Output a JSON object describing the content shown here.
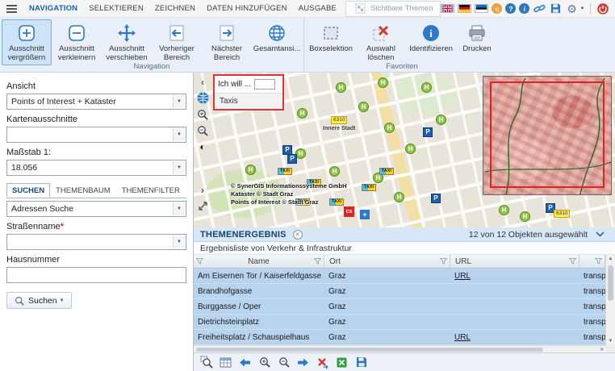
{
  "menubar": {
    "tabs": [
      {
        "label": "NAVIGATION"
      },
      {
        "label": "SELEKTIEREN"
      },
      {
        "label": "ZEICHNEN"
      },
      {
        "label": "DATEN HINZUFÜGEN"
      },
      {
        "label": "AUSGABE"
      }
    ],
    "sichtbare_themen_label": "Sichtbare Themen",
    "badges": {
      "copyright": "c",
      "help": "?",
      "info": "i"
    }
  },
  "ribbon": {
    "navigation_group_label": "Navigation",
    "favoriten_group_label": "Favoriten",
    "buttons": {
      "zoom_in": "Ausschnitt vergrößern",
      "zoom_out": "Ausschnitt verkleinern",
      "pan": "Ausschnitt verschieben",
      "prev": "Vorheriger Bereich",
      "next": "Nächster Bereich",
      "full": "Gesamtansi...",
      "box_select": "Boxselektion",
      "clear_selection": "Auswahl löschen",
      "identify": "Identifizieren",
      "print": "Drucken"
    }
  },
  "sidebar": {
    "ansicht": {
      "label": "Ansicht",
      "value": "Points of Interest + Kataster"
    },
    "kartenausschnitte": {
      "label": "Kartenausschnitte",
      "value": ""
    },
    "massstab": {
      "label": "Maßstab 1:",
      "value": "18.056"
    },
    "tabs": [
      {
        "label": "SUCHEN"
      },
      {
        "label": "THEMENBAUM"
      },
      {
        "label": "THEMENFILTER"
      }
    ],
    "suchdienst_value": "Adressen Suche",
    "strassenname_label": "Straßenname",
    "required_marker": "*",
    "strassenname_value": "",
    "hausnummer_label": "Hausnummer",
    "hausnummer_value": "",
    "suchen_button_label": "Suchen"
  },
  "map": {
    "popup": {
      "prompt": "Ich will ...",
      "input_value": "",
      "suggestion": "Taxis"
    },
    "copyright_line1": "© SynerGIS Informationssysteme GmbH",
    "copyright_line2": "Kataster © Stadt Graz",
    "copyright_line3": "Points of Interest © Stadt Graz",
    "district_code": "6310",
    "district_name": "Innere Stadt",
    "marker_labels": {
      "stop": "H",
      "parking": "P",
      "taxi": "TAXI",
      "cs": "cs",
      "cross": "+"
    }
  },
  "results": {
    "title": "THEMENERGEBNIS",
    "selection_status": "12 von 12 Objekten ausgewählt",
    "subtitle": "Ergebnisliste von Verkehr & Infrastruktur",
    "columns": {
      "name": "Name",
      "ort": "Ort",
      "url": "URL"
    },
    "rows": [
      {
        "name": "Am Eisernen Tor / Kaiserfeldgasse",
        "ort": "Graz",
        "url": "URL",
        "theme": "transport"
      },
      {
        "name": "Brandhofgasse",
        "ort": "Graz",
        "url": "",
        "theme": "transport"
      },
      {
        "name": "Burggasse / Oper",
        "ort": "Graz",
        "url": "",
        "theme": "transport"
      },
      {
        "name": "Dietrichsteinplatz",
        "ort": "Graz",
        "url": "",
        "theme": "transport"
      },
      {
        "name": "Freiheitsplatz / Schauspielhaus",
        "ort": "Graz",
        "url": "URL",
        "theme": "transport"
      }
    ]
  },
  "icons": {
    "caret_down": "▼",
    "chevron_left": "‹",
    "chevron_right": "›",
    "double_chevron_right": "»",
    "contrast": "◐",
    "close": "×",
    "scroll_up": "▲",
    "scroll_down": "▼",
    "gear": "⚙"
  }
}
